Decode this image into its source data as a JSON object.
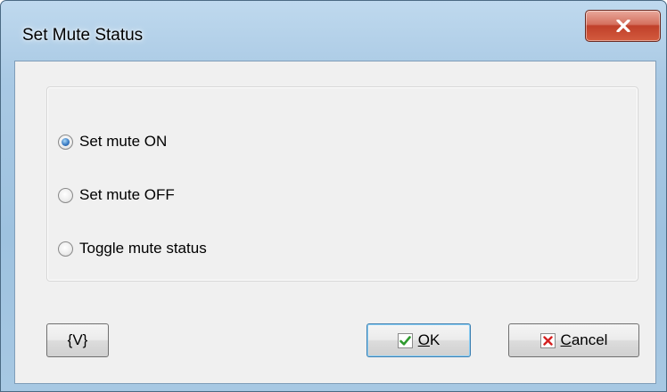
{
  "window": {
    "title": "Set Mute Status"
  },
  "options": [
    {
      "label": "Set mute ON",
      "checked": true
    },
    {
      "label": "Set mute OFF",
      "checked": false
    },
    {
      "label": "Toggle mute status",
      "checked": false
    }
  ],
  "buttons": {
    "variables_label": "{V}",
    "ok_label": "OK",
    "cancel_label": "Cancel"
  },
  "icons": {
    "close": "close-icon",
    "ok": "checkmark-icon",
    "cancel": "x-icon"
  },
  "colors": {
    "ok_check": "#2e9a2e",
    "cancel_x": "#d42020",
    "close_button": "#c7432c",
    "radio_selected": "#3b7cc4"
  }
}
